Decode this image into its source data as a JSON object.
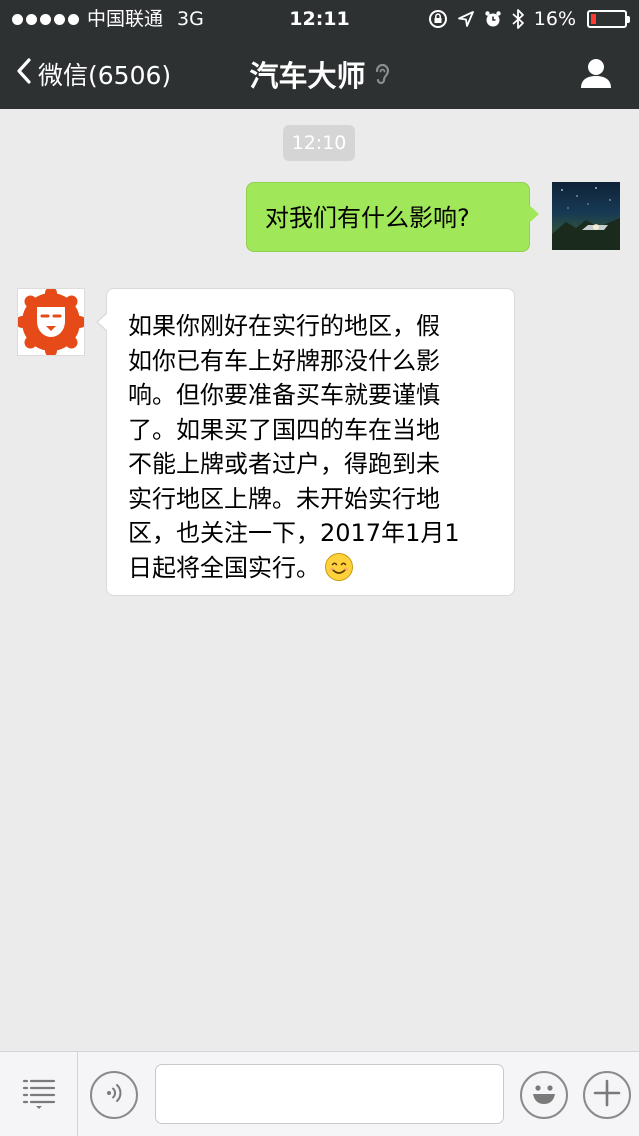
{
  "status_bar": {
    "carrier": "中国联通",
    "network": "3G",
    "time": "12:11",
    "battery_percent": "16%",
    "battery_level": 0.16,
    "icons": [
      "rotation-lock-icon",
      "location-icon",
      "alarm-icon",
      "bluetooth-icon",
      "battery-icon"
    ]
  },
  "nav": {
    "back_label": "微信(6506)",
    "title": "汽车大师",
    "icons": [
      "back-chevron-icon",
      "ear-icon",
      "profile-icon"
    ]
  },
  "chat": {
    "timestamp": "12:10",
    "messages": [
      {
        "direction": "outgoing",
        "text": "对我们有什么影响?"
      },
      {
        "direction": "incoming",
        "lines": [
          "如果你刚好在实行的地区，假",
          "如你已有车上好牌那没什么影",
          "响。但你要准备买车就要谨慎",
          "了。如果买了国四的车在当地",
          "不能上牌或者过户，得跑到未",
          "实行地区上牌。未开始实行地",
          "区，也关注一下，2017年1月1",
          "日起将全国实行。"
        ],
        "emoji": "smile-emoji-icon"
      }
    ]
  },
  "input_bar": {
    "message_value": "",
    "icons": [
      "menu-list-icon",
      "voice-icon",
      "emoji-icon",
      "plus-icon"
    ]
  },
  "colors": {
    "bar_background": "#2e3132",
    "chat_background": "#ebebeb",
    "outgoing_bubble": "#a0e75a",
    "incoming_bubble": "#ffffff",
    "bot_avatar": "#e64a19",
    "battery_low": "#ff3b30"
  }
}
